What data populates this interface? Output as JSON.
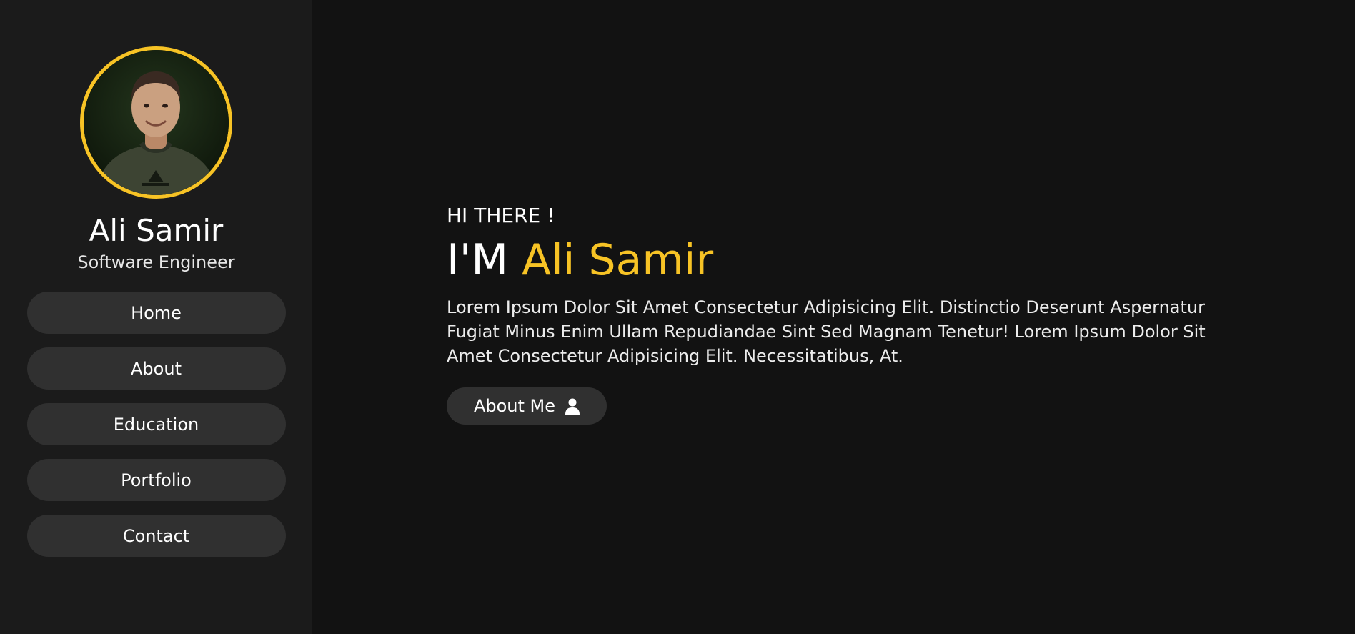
{
  "colors": {
    "accent": "#f7c325",
    "sidebar_bg": "#1b1b1b",
    "main_bg": "#121212",
    "button_bg": "#303030"
  },
  "profile": {
    "name": "Ali Samir",
    "role": "Software Engineer",
    "avatar_icon": "profile-photo"
  },
  "nav": {
    "items": [
      {
        "label": "Home"
      },
      {
        "label": "About"
      },
      {
        "label": "Education"
      },
      {
        "label": "Portfolio"
      },
      {
        "label": "Contact"
      }
    ]
  },
  "hero": {
    "greeting": "HI THERE !",
    "headline_prefix": "I'M",
    "headline_name": "Ali Samir",
    "bio": "Lorem Ipsum Dolor Sit Amet Consectetur Adipisicing Elit. Distinctio Deserunt Aspernatur Fugiat Minus Enim Ullam Repudiandae Sint Sed Magnam Tenetur! Lorem Ipsum Dolor Sit Amet Consectetur Adipisicing Elit. Necessitatibus, At.",
    "cta_label": "About Me",
    "cta_icon": "user-icon"
  }
}
